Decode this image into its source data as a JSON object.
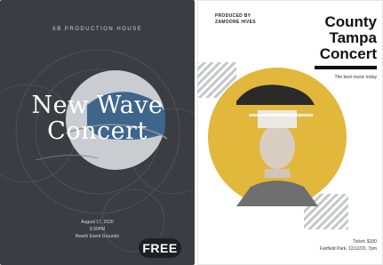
{
  "posters": [
    {
      "production_house": "XB PRODUCTION HOUSE",
      "title_line1": "New Wave",
      "title_line2": "Concert",
      "date": "August 17, 2020",
      "time": "9:30PM",
      "venue": "Beach Event Grounds",
      "badge": "FREE",
      "colors": {
        "background": "#3a3d41",
        "circle": "#c9ccd0",
        "accent": "#2f5a84"
      }
    },
    {
      "produced_by_label": "PRODUCED BY",
      "producer": "ZAMOORE HIVES",
      "title_line1": "County",
      "title_line2": "Tampa",
      "title_line3": "Concert",
      "tagline": "The best music today",
      "ticket": "Ticket: $100",
      "details": "Fairfield Park, 12/12/20, 7pm",
      "colors": {
        "background": "#ffffff",
        "circle": "#e1b73c",
        "text": "#111111"
      }
    }
  ]
}
